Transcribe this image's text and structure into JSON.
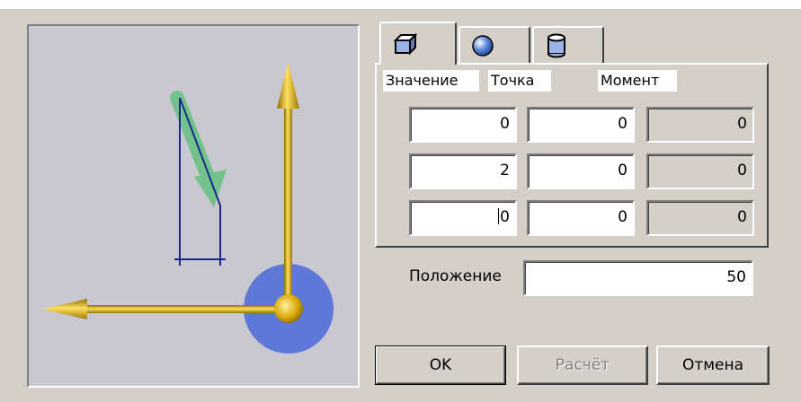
{
  "tabs": [
    {
      "icon": "cube-icon",
      "active": true
    },
    {
      "icon": "sphere-icon",
      "active": false
    },
    {
      "icon": "cylinder-icon",
      "active": false
    }
  ],
  "columns": {
    "value": "Значение",
    "point": "Точка",
    "moment": "Момент"
  },
  "rows": [
    {
      "value": "0",
      "point": "0",
      "moment": "0"
    },
    {
      "value": "2",
      "point": "0",
      "moment": "0"
    },
    {
      "value": "0",
      "point": "0",
      "moment": "0"
    }
  ],
  "position": {
    "label": "Положение",
    "value": "50"
  },
  "buttons": {
    "ok": "OK",
    "calculate": "Расчёт",
    "cancel": "Отмена"
  },
  "colors": {
    "axis_gold": "#e0b400",
    "force_arrow": "#50c070",
    "center_sphere": "#4a6ad8",
    "dimension_line": "#1a2a8a",
    "viewport_bg": "#c9c7d0"
  }
}
